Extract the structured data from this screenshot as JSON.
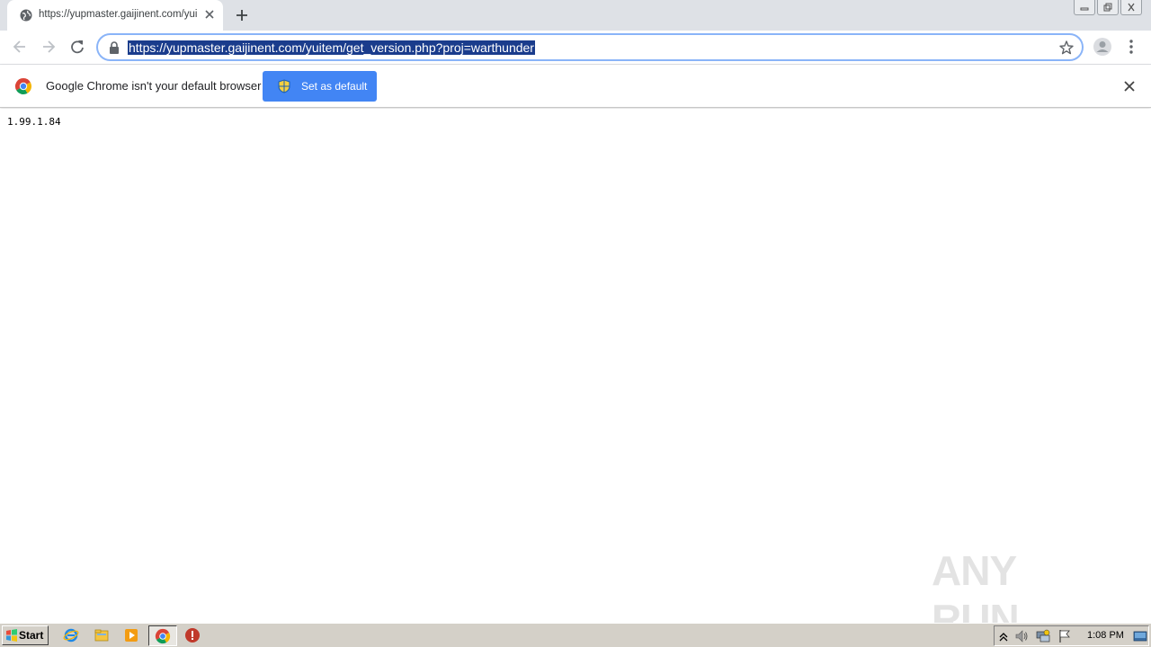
{
  "browser": {
    "tab": {
      "title": "https://yupmaster.gaijinent.com/yuitem/get_version.php?proj=warthunder"
    },
    "omnibox": {
      "url": "https://yupmaster.gaijinent.com/yuitem/get_version.php?proj=warthunder"
    }
  },
  "infobar": {
    "message": "Google Chrome isn't your default browser",
    "button_label": "Set as default"
  },
  "page": {
    "text": "1.99.1.84"
  },
  "watermark": {
    "text": "ANY RUN"
  },
  "taskbar": {
    "start_label": "Start",
    "clock": "1:08 PM"
  },
  "colors": {
    "accent_blue": "#4285f4",
    "url_selection": "#1a3c8c",
    "taskbar": "#d4d0c8"
  }
}
